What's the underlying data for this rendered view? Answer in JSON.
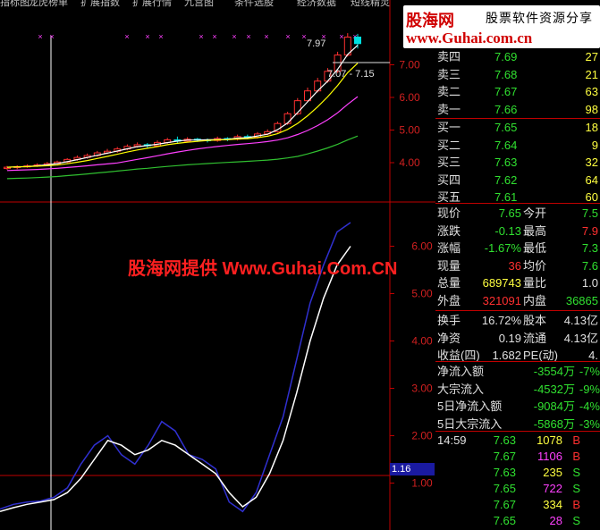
{
  "topbar": {
    "items": [
      "指标图",
      "龙虎榜单",
      "扩展指数",
      "扩展行情",
      "九宫图",
      "条件选股",
      "经济数据",
      "短线精灵"
    ]
  },
  "logo": {
    "brand": "股海网",
    "slogan": "股票软件资源分享",
    "url": "www.Guhai.com.cn"
  },
  "watermark": "股海网提供 Www.Guhai.Com.CN",
  "price_chart": {
    "high_label": "7.97",
    "range_label": "7.07 - 7.15",
    "y_ticks": [
      "7.00",
      "6.00",
      "5.00",
      "4.00"
    ],
    "y_values": [
      7.0,
      6.0,
      5.0,
      4.0
    ],
    "candles": [
      {
        "o": 3.82,
        "c": 3.86,
        "h": 3.9,
        "l": 3.78
      },
      {
        "o": 3.85,
        "c": 3.88,
        "h": 3.92,
        "l": 3.8
      },
      {
        "o": 3.87,
        "c": 3.9,
        "h": 3.95,
        "l": 3.84
      },
      {
        "o": 3.9,
        "c": 3.93,
        "h": 3.98,
        "l": 3.87
      },
      {
        "o": 3.93,
        "c": 3.97,
        "h": 4.02,
        "l": 3.9
      },
      {
        "o": 3.97,
        "c": 4.02,
        "h": 4.06,
        "l": 3.94
      },
      {
        "o": 4.02,
        "c": 4.1,
        "h": 4.14,
        "l": 3.99
      },
      {
        "o": 4.1,
        "c": 4.16,
        "h": 4.22,
        "l": 4.06
      },
      {
        "o": 4.16,
        "c": 4.22,
        "h": 4.28,
        "l": 4.12
      },
      {
        "o": 4.22,
        "c": 4.3,
        "h": 4.36,
        "l": 4.18
      },
      {
        "o": 4.3,
        "c": 4.35,
        "h": 4.42,
        "l": 4.26
      },
      {
        "o": 4.35,
        "c": 4.42,
        "h": 4.48,
        "l": 4.3
      },
      {
        "o": 4.42,
        "c": 4.5,
        "h": 4.56,
        "l": 4.38
      },
      {
        "o": 4.5,
        "c": 4.55,
        "h": 4.62,
        "l": 4.46
      },
      {
        "o": 4.55,
        "c": 4.52,
        "h": 4.6,
        "l": 4.44
      },
      {
        "o": 4.52,
        "c": 4.62,
        "h": 4.68,
        "l": 4.48
      },
      {
        "o": 4.62,
        "c": 4.7,
        "h": 4.76,
        "l": 4.58
      },
      {
        "o": 4.7,
        "c": 4.66,
        "h": 4.8,
        "l": 4.6
      },
      {
        "o": 4.66,
        "c": 4.72,
        "h": 4.78,
        "l": 4.62
      },
      {
        "o": 4.72,
        "c": 4.7,
        "h": 4.76,
        "l": 4.64
      },
      {
        "o": 4.7,
        "c": 4.68,
        "h": 4.74,
        "l": 4.62
      },
      {
        "o": 4.68,
        "c": 4.74,
        "h": 4.8,
        "l": 4.64
      },
      {
        "o": 4.74,
        "c": 4.72,
        "h": 4.78,
        "l": 4.66
      },
      {
        "o": 4.72,
        "c": 4.8,
        "h": 4.86,
        "l": 4.68
      },
      {
        "o": 4.8,
        "c": 4.78,
        "h": 4.86,
        "l": 4.72
      },
      {
        "o": 4.78,
        "c": 4.88,
        "h": 4.94,
        "l": 4.74
      },
      {
        "o": 4.88,
        "c": 4.95,
        "h": 5.02,
        "l": 4.84
      },
      {
        "o": 4.95,
        "c": 5.2,
        "h": 5.26,
        "l": 4.92
      },
      {
        "o": 5.2,
        "c": 5.5,
        "h": 5.56,
        "l": 5.16
      },
      {
        "o": 5.5,
        "c": 5.9,
        "h": 5.98,
        "l": 5.46
      },
      {
        "o": 5.9,
        "c": 6.2,
        "h": 6.3,
        "l": 5.86
      },
      {
        "o": 6.2,
        "c": 6.5,
        "h": 6.6,
        "l": 6.15
      },
      {
        "o": 6.5,
        "c": 6.8,
        "h": 6.9,
        "l": 6.45
      },
      {
        "o": 6.8,
        "c": 7.3,
        "h": 7.4,
        "l": 6.75
      },
      {
        "o": 7.3,
        "c": 7.85,
        "h": 7.97,
        "l": 7.25
      },
      {
        "o": 7.85,
        "c": 7.65,
        "h": 7.95,
        "l": 7.5
      }
    ]
  },
  "indicator_chart": {
    "y_ticks": [
      "6.00",
      "5.00",
      "4.00",
      "3.00",
      "2.00",
      "1.00"
    ],
    "y_values": [
      6.0,
      5.0,
      4.0,
      3.0,
      2.0,
      1.0
    ],
    "current_value": "1.16",
    "line1": [
      0.45,
      0.55,
      0.6,
      0.62,
      0.7,
      0.9,
      1.4,
      1.8,
      2.0,
      1.6,
      1.4,
      1.8,
      2.3,
      2.1,
      1.6,
      1.5,
      1.3,
      0.6,
      0.4,
      0.8,
      1.6,
      2.4,
      3.6,
      4.8,
      5.6,
      6.3,
      6.5
    ],
    "line2": [
      0.4,
      0.48,
      0.55,
      0.6,
      0.65,
      0.8,
      1.1,
      1.5,
      1.9,
      1.8,
      1.6,
      1.7,
      1.9,
      1.8,
      1.6,
      1.4,
      1.2,
      0.8,
      0.5,
      0.7,
      1.2,
      1.9,
      2.9,
      4.0,
      4.9,
      5.6,
      6.0
    ]
  },
  "quote": {
    "asks": [
      {
        "label": "卖四",
        "price": "7.69",
        "vol": "27"
      },
      {
        "label": "卖三",
        "price": "7.68",
        "vol": "21"
      },
      {
        "label": "卖二",
        "price": "7.67",
        "vol": "63"
      },
      {
        "label": "卖一",
        "price": "7.66",
        "vol": "98"
      }
    ],
    "bids": [
      {
        "label": "买一",
        "price": "7.65",
        "vol": "18"
      },
      {
        "label": "买二",
        "price": "7.64",
        "vol": "9"
      },
      {
        "label": "买三",
        "price": "7.63",
        "vol": "32"
      },
      {
        "label": "买四",
        "price": "7.62",
        "vol": "64"
      },
      {
        "label": "买五",
        "price": "7.61",
        "vol": "60"
      }
    ],
    "stats": [
      {
        "l1": "现价",
        "v1": "7.65",
        "l2": "今开",
        "v2": "7.5"
      },
      {
        "l1": "涨跌",
        "v1": "-0.13",
        "l2": "最高",
        "v2": "7.9"
      },
      {
        "l1": "涨幅",
        "v1": "-1.67%",
        "l2": "最低",
        "v2": "7.3"
      },
      {
        "l1": "现量",
        "v1": "36",
        "l2": "均价",
        "v2": "7.6"
      },
      {
        "l1": "总量",
        "v1": "689743",
        "l2": "量比",
        "v2": "1.0"
      },
      {
        "l1": "外盘",
        "v1": "321091",
        "l2": "内盘",
        "v2": "36865"
      }
    ],
    "stats2": [
      {
        "l1": "换手",
        "v1": "16.72%",
        "l2": "股本",
        "v2": "4.13亿"
      },
      {
        "l1": "净资",
        "v1": "0.19",
        "l2": "流通",
        "v2": "4.13亿"
      },
      {
        "l1": "收益(四)",
        "v1": "1.682",
        "l2": "PE(动)",
        "v2": "4."
      }
    ],
    "flows": [
      {
        "label": "净流入额",
        "value": "-3554万",
        "pct": "-7%"
      },
      {
        "label": "大宗流入",
        "value": "-4532万",
        "pct": "-9%"
      },
      {
        "label": "5日净流入额",
        "value": "-9084万",
        "pct": "-4%"
      },
      {
        "label": "5日大宗流入",
        "value": "-5868万",
        "pct": "-3%"
      }
    ],
    "ticks": [
      {
        "time": "14:59",
        "price": "7.63",
        "vol": "1078",
        "side": "B"
      },
      {
        "time": "",
        "price": "7.67",
        "vol": "1106",
        "side": "B"
      },
      {
        "time": "",
        "price": "7.63",
        "vol": "235",
        "side": "S"
      },
      {
        "time": "",
        "price": "7.65",
        "vol": "722",
        "side": "S"
      },
      {
        "time": "",
        "price": "7.67",
        "vol": "334",
        "side": "B"
      },
      {
        "time": "",
        "price": "7.65",
        "vol": "28",
        "side": "S"
      }
    ]
  },
  "colors": {
    "up": "#ff3030",
    "down": "#00e0e0",
    "green": "#30e030",
    "label": "#e0e0e0",
    "grid": "#c00000",
    "ma_white": "#ffffff",
    "ma_yellow": "#ffff00",
    "ma_magenta": "#ff40ff",
    "ma_green": "#30c030",
    "ind_blue": "#3030d0"
  }
}
